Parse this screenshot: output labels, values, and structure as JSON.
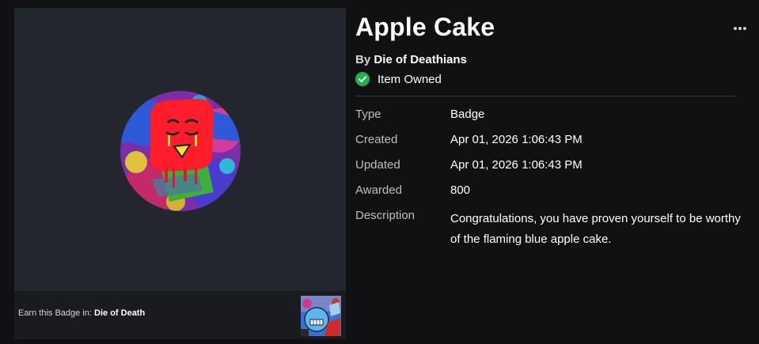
{
  "item": {
    "title": "Apple Cake",
    "by_prefix": "By",
    "creator": "Die of Deathians",
    "owned_label": "Item Owned"
  },
  "earn": {
    "prefix": "Earn this Badge in: ",
    "game": "Die of Death"
  },
  "details": {
    "type_label": "Type",
    "type_value": "Badge",
    "created_label": "Created",
    "created_value": "Apr 01, 2026 1:06:43 PM",
    "updated_label": "Updated",
    "updated_value": "Apr 01, 2026 1:06:43 PM",
    "awarded_label": "Awarded",
    "awarded_value": "800",
    "description_label": "Description",
    "description_value": "Congratulations, you have proven yourself to be worthy of the flaming blue apple cake."
  },
  "colors": {
    "background": "#111114",
    "panel": "#24262d",
    "owned_green": "#22b14c"
  },
  "icons": {
    "more": "more-options-icon",
    "owned": "check-circle-icon"
  }
}
